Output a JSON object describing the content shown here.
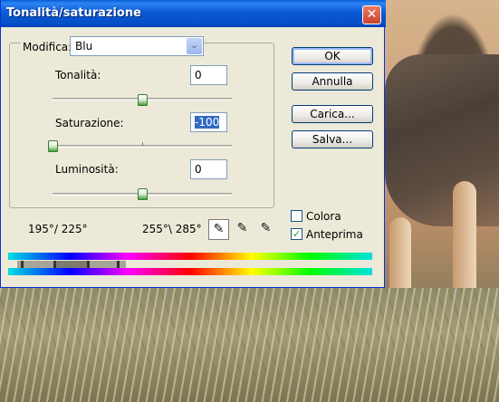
{
  "dialog": {
    "title": "Tonalità/saturazione",
    "close_glyph": "✕"
  },
  "edit": {
    "label": "Modifica:",
    "value": "Blu",
    "arrow_glyph": "⌄"
  },
  "sliders": {
    "hue": {
      "label": "Tonalità:",
      "value": "0",
      "level": 0.5
    },
    "saturation": {
      "label": "Saturazione:",
      "value": "-100",
      "level": 0.0
    },
    "lightness": {
      "label": "Luminosità:",
      "value": "0",
      "level": 0.5
    }
  },
  "buttons": {
    "ok": "OK",
    "cancel": "Annulla",
    "load": "Carica...",
    "save": "Salva..."
  },
  "checkboxes": {
    "colorize": {
      "label": "Colora",
      "checked": false
    },
    "preview": {
      "label": "Anteprima",
      "checked": true,
      "glyph": "✓"
    }
  },
  "ranges": {
    "left": "195°/ 225°",
    "right": "255°\\ 285°"
  },
  "eyedroppers": [
    {
      "name": "eyedropper-icon",
      "glyph": "✎"
    },
    {
      "name": "eyedropper-plus-icon",
      "glyph": "✎"
    },
    {
      "name": "eyedropper-minus-icon",
      "glyph": "✎"
    }
  ],
  "colors": {
    "titlebar": "#0550c8",
    "dialog_bg": "#ece9d8",
    "selection": "#316ac5",
    "thumb_green": "#43a338"
  }
}
